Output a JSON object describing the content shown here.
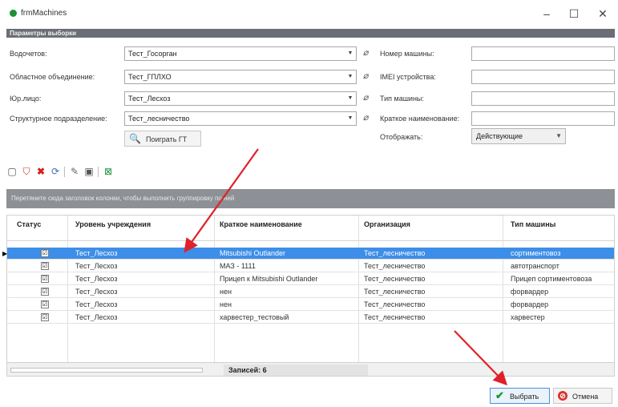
{
  "window": {
    "title": "frmMachines",
    "minimize_glyph": "–",
    "maximize_glyph": "☐",
    "close_glyph": "✕"
  },
  "section": {
    "header": "Параметры выборки"
  },
  "form": {
    "left": [
      {
        "label": "Водочетов:",
        "value": "Тест_Госорган"
      },
      {
        "label": "Областное объединение:",
        "value": "Тест_ГПЛХО"
      },
      {
        "label": "Юр.лицо:",
        "value": "Тест_Лесхоз"
      },
      {
        "label": "Структурное подразделение:",
        "value": "Тест_лесничество"
      }
    ],
    "right": [
      {
        "label": "Номер машины:",
        "value": ""
      },
      {
        "label": "IMEI устройства:",
        "value": ""
      },
      {
        "label": "Тип машины:",
        "value": ""
      },
      {
        "label": "Краткое наименование:",
        "value": ""
      }
    ],
    "find_button": "Поиграть ГТ",
    "show_label": "Отображать:",
    "show_value": "Действующие"
  },
  "group_panel": "Перетяните сюда заголовок колонки, чтобы выполнить группировку по ней",
  "table": {
    "headers": [
      "Статус",
      "Уровень учреждения",
      "Краткое наименование",
      "Организация",
      "Тип машины"
    ],
    "rows": [
      {
        "checked": "☑",
        "level": "Тест_Лесхоз",
        "name": "Mitsubishi Outlander",
        "org": "Тест_лесничество",
        "type": "сортиментовоз"
      },
      {
        "checked": "☑",
        "level": "Тест_Лесхоз",
        "name": "МАЗ - 1111",
        "org": "Тест_лесничество",
        "type": "автотранспорт"
      },
      {
        "checked": "☑",
        "level": "Тест_Лесхоз",
        "name": "Прицеп к Mitsubishi Outlander",
        "org": "Тест_лесничество",
        "type": "Прицеп сортиментовоза"
      },
      {
        "checked": "☑",
        "level": "Тест_Лесхоз",
        "name": "нен",
        "org": "Тест_лесничество",
        "type": "форвардер"
      },
      {
        "checked": "☑",
        "level": "Тест_Лесхоз",
        "name": "нен",
        "org": "Тест_лесничество",
        "type": "форвардер"
      },
      {
        "checked": "☑",
        "level": "Тест_Лесхоз",
        "name": "харвестер_тестовый",
        "org": "Тест_лесничество",
        "type": "харвестер"
      }
    ],
    "selected_row_indicator": "▶"
  },
  "footer": {
    "summary": "Записей: 6"
  },
  "buttons": {
    "select": "Выбрать",
    "cancel": "Отмена"
  },
  "icons": {
    "select": "✔",
    "cancel": "⊘",
    "clear": "⌀",
    "find": "🔍",
    "dropdown": "▼"
  },
  "colors": {
    "selected_row": "#3d8ee8",
    "annotation_arrow": "#e0202a",
    "section_header": "#6b6f75"
  }
}
